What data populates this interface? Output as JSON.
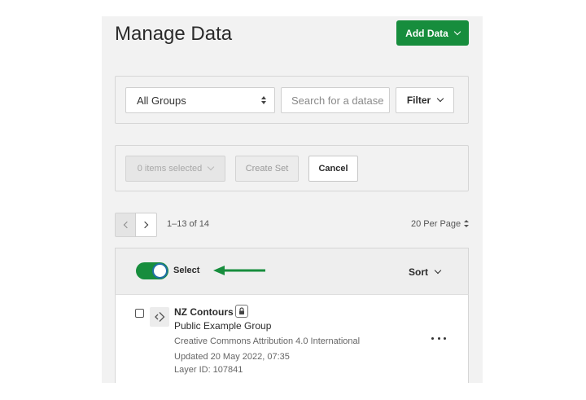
{
  "page": {
    "title": "Manage Data"
  },
  "header": {
    "add_data_label": "Add Data"
  },
  "filters": {
    "group_select_value": "All Groups",
    "search_placeholder": "Search for a datase",
    "filter_label": "Filter"
  },
  "selection_bar": {
    "items_selected_label": "0 items selected",
    "create_set_label": "Create Set",
    "cancel_label": "Cancel"
  },
  "pagination": {
    "range_text": "1–13 of 14",
    "per_page_label": "20 Per Page"
  },
  "list_header": {
    "select_toggle_on": true,
    "select_label": "Select",
    "sort_label": "Sort"
  },
  "items": [
    {
      "title": "NZ Contours",
      "group": "Public Example Group",
      "license": "Creative Commons Attribution 4.0 International",
      "updated": "Updated 20 May 2022, 07:35",
      "layer_id": "Layer ID: 107841",
      "type_icon": "vector-line-icon",
      "locked": true
    }
  ],
  "colors": {
    "primary_green": "#178d3d",
    "annotation_arrow": "#178d3d",
    "toggle_knob_border": "#1f6fa5",
    "panel_bg": "#f2f2f2"
  }
}
